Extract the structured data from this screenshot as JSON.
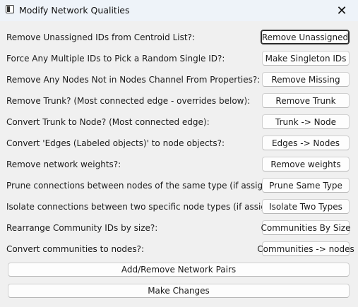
{
  "window": {
    "title": "Modify Network Qualities",
    "close_glyph": "✕"
  },
  "rows": [
    {
      "label": "Remove Unassigned IDs from Centroid List?:",
      "button": "Remove Unassigned"
    },
    {
      "label": "Force Any Multiple IDs to Pick a Random Single ID?:",
      "button": "Make Singleton IDs"
    },
    {
      "label": "Remove Any Nodes Not in Nodes Channel From Properties?:",
      "button": "Remove Missing"
    },
    {
      "label": "Remove Trunk? (Most connected edge - overrides below):",
      "button": "Remove Trunk"
    },
    {
      "label": "Convert Trunk to Node? (Most connected edge):",
      "button": "Trunk -> Node"
    },
    {
      "label": "Convert 'Edges (Labeled objects)' to node objects?:",
      "button": "Edges -> Nodes"
    },
    {
      "label": "Remove network weights?:",
      "button": "Remove weights"
    },
    {
      "label": "Prune connections between nodes of the same type (if assigned)?:",
      "button": "Prune Same Type"
    },
    {
      "label": "Isolate connections between two specific node types (if assigned)?:",
      "button": "Isolate Two Types"
    },
    {
      "label": "Rearrange Community IDs by size?:",
      "button": "Communities By Size"
    },
    {
      "label": "Convert communities to nodes?:",
      "button": "Communities -> nodes"
    }
  ],
  "footer": {
    "add_remove_pairs": "Add/Remove Network Pairs",
    "make_changes": "Make Changes"
  }
}
